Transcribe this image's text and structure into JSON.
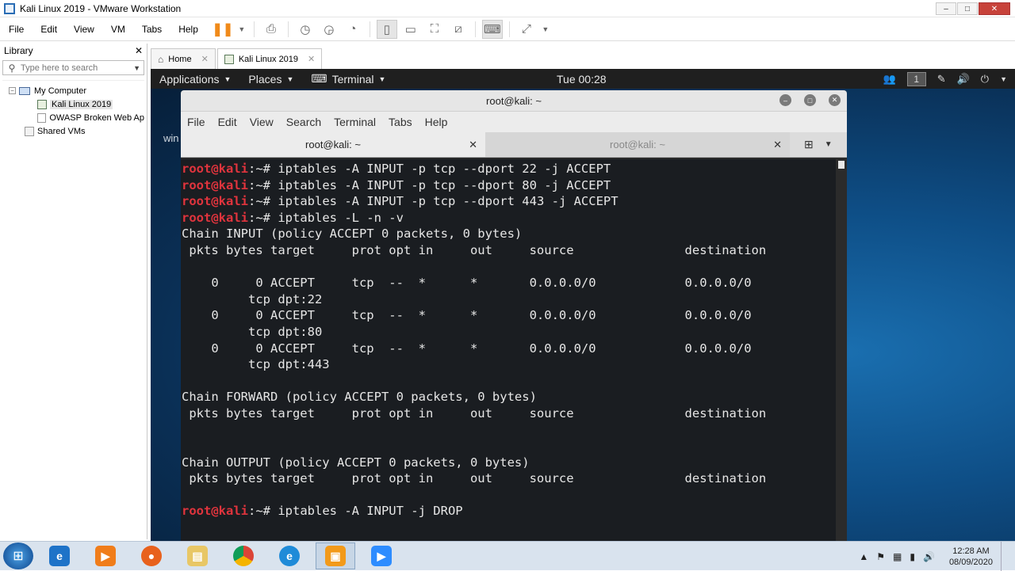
{
  "window": {
    "title": "Kali Linux 2019 - VMware Workstation",
    "controls": [
      "–",
      "□",
      "✕"
    ]
  },
  "menubar": {
    "items": [
      "File",
      "Edit",
      "View",
      "VM",
      "Tabs",
      "Help"
    ]
  },
  "library": {
    "title": "Library",
    "close": "✕",
    "search_placeholder": "Type here to search",
    "tree": {
      "root": "My Computer",
      "vms": [
        "Kali Linux 2019",
        "OWASP Broken Web Ap"
      ],
      "shared": "Shared VMs"
    }
  },
  "tabs": [
    {
      "label": "Home"
    },
    {
      "label": "Kali Linux 2019"
    }
  ],
  "gnome": {
    "applications": "Applications",
    "places": "Places",
    "terminal": "Terminal",
    "clock": "Tue 00:28",
    "workspace": "1"
  },
  "desktop_text": "win",
  "terminal": {
    "title": "root@kali: ~",
    "menu": [
      "File",
      "Edit",
      "View",
      "Search",
      "Terminal",
      "Tabs",
      "Help"
    ],
    "tabs": [
      "root@kali: ~",
      "root@kali: ~"
    ],
    "prompt_user": "root@kali",
    "prompt_suffix": ":~# ",
    "lines": [
      {
        "type": "cmd",
        "text": "iptables -A INPUT -p tcp --dport 22 -j ACCEPT"
      },
      {
        "type": "cmd",
        "text": "iptables -A INPUT -p tcp --dport 80 -j ACCEPT"
      },
      {
        "type": "cmd",
        "text": "iptables -A INPUT -p tcp --dport 443 -j ACCEPT"
      },
      {
        "type": "cmd",
        "text": "iptables -L -n -v"
      },
      {
        "type": "out",
        "text": "Chain INPUT (policy ACCEPT 0 packets, 0 bytes)"
      },
      {
        "type": "out",
        "text": " pkts bytes target     prot opt in     out     source               destination"
      },
      {
        "type": "out",
        "text": ""
      },
      {
        "type": "out",
        "text": "    0     0 ACCEPT     tcp  --  *      *       0.0.0.0/0            0.0.0.0/0"
      },
      {
        "type": "out",
        "text": "         tcp dpt:22"
      },
      {
        "type": "out",
        "text": "    0     0 ACCEPT     tcp  --  *      *       0.0.0.0/0            0.0.0.0/0"
      },
      {
        "type": "out",
        "text": "         tcp dpt:80"
      },
      {
        "type": "out",
        "text": "    0     0 ACCEPT     tcp  --  *      *       0.0.0.0/0            0.0.0.0/0"
      },
      {
        "type": "out",
        "text": "         tcp dpt:443"
      },
      {
        "type": "out",
        "text": ""
      },
      {
        "type": "out",
        "text": "Chain FORWARD (policy ACCEPT 0 packets, 0 bytes)"
      },
      {
        "type": "out",
        "text": " pkts bytes target     prot opt in     out     source               destination"
      },
      {
        "type": "out",
        "text": ""
      },
      {
        "type": "out",
        "text": ""
      },
      {
        "type": "out",
        "text": "Chain OUTPUT (policy ACCEPT 0 packets, 0 bytes)"
      },
      {
        "type": "out",
        "text": " pkts bytes target     prot opt in     out     source               destination"
      },
      {
        "type": "out",
        "text": ""
      },
      {
        "type": "cmd",
        "text": "iptables -A INPUT -j DROP"
      }
    ]
  },
  "taskbar": {
    "apps": [
      "internet-explorer",
      "media-player",
      "firefox",
      "file-explorer",
      "chrome",
      "edge",
      "vmware",
      "zoom"
    ],
    "time": "12:28 AM",
    "date": "08/09/2020"
  }
}
